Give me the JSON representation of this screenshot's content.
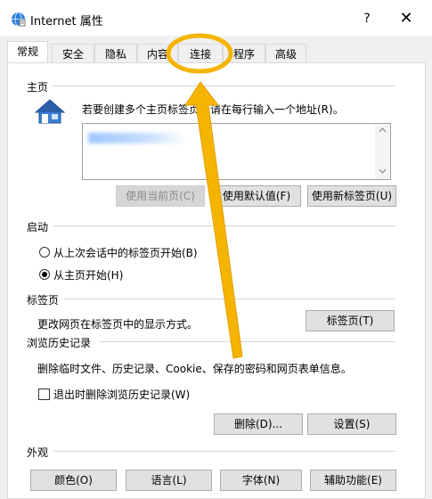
{
  "window": {
    "title": "Internet 属性",
    "help_label": "?",
    "close_label": "✕",
    "icon": "internet-options-icon"
  },
  "tabs": [
    {
      "label": "常规",
      "active": true
    },
    {
      "label": "安全",
      "active": false
    },
    {
      "label": "隐私",
      "active": false
    },
    {
      "label": "内容",
      "active": false
    },
    {
      "label": "连接",
      "active": false
    },
    {
      "label": "程序",
      "active": false
    },
    {
      "label": "高级",
      "active": false
    }
  ],
  "homepage": {
    "heading": "主页",
    "icon": "house-icon",
    "description": "若要创建多个主页标签页，请在每行输入一个地址(R)。",
    "buttons": {
      "use_current": "使用当前页(C)",
      "use_default": "使用默认值(F)",
      "use_new_tab": "使用新标签页(U)"
    }
  },
  "startup": {
    "heading": "启动",
    "option_last_session": "从上次会话中的标签页开始(B)",
    "option_home": "从主页开始(H)"
  },
  "tabs_section": {
    "heading": "标签页",
    "description": "更改网页在标签页中的显示方式。",
    "button": "标签页(T)"
  },
  "history": {
    "heading": "浏览历史记录",
    "description": "删除临时文件、历史记录、Cookie、保存的密码和网页表单信息。",
    "checkbox_label": "退出时删除浏览历史记录(W)",
    "delete_button": "删除(D)...",
    "settings_button": "设置(S)"
  },
  "appearance": {
    "heading": "外观",
    "colors_button": "颜色(O)",
    "languages_button": "语言(L)",
    "fonts_button": "字体(N)",
    "accessibility_button": "辅助功能(E)"
  },
  "colors": {
    "annotation": "#f5b400",
    "window_bg": "#f0f0f0",
    "panel_bg": "#ffffff"
  }
}
